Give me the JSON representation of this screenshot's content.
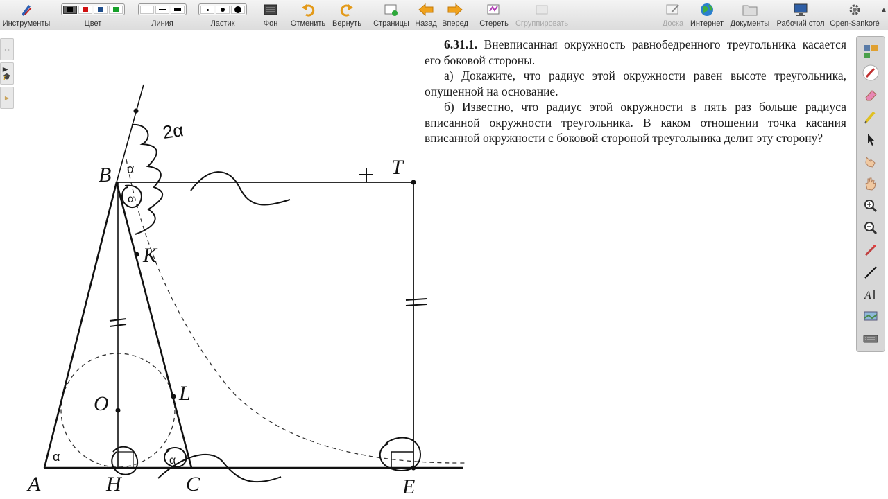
{
  "toolbar": {
    "tools": "Инструменты",
    "color": "Цвет",
    "line": "Линия",
    "eraser": "Ластик",
    "background": "Фон",
    "undo": "Отменить",
    "redo": "Вернуть",
    "pages": "Страницы",
    "back": "Назад",
    "forward": "Вперед",
    "erase": "Стереть",
    "group": "Сгруппировать",
    "board": "Доска",
    "internet": "Интернет",
    "documents": "Документы",
    "desktop": "Рабочий стол",
    "app": "Open-Sankoré",
    "colors": [
      "#000000",
      "#d01010",
      "#1f4e8c",
      "#16a02a"
    ]
  },
  "problem": {
    "number": "6.31.1.",
    "intro": "Вневписанная окружность равнобедренного треугольника касается его боковой стороны.",
    "part_a": "а) Докажите, что радиус этой окружности равен высоте треугольника, опущенной на основание.",
    "part_b": "б) Известно, что радиус этой окружности в пять раз больше радиуса вписанной окружности треугольника. В каком отношении точка касания вписанной окружности с боковой стороной треугольника делит эту сторону?"
  },
  "drawing": {
    "labels": {
      "A": "A",
      "B": "B",
      "C": "C",
      "H": "H",
      "E": "E",
      "T": "T",
      "K": "K",
      "L": "L",
      "O": "O"
    },
    "annotations": {
      "two_alpha": "2α",
      "alpha": "α",
      "plus": "+",
      "equal": "="
    }
  }
}
